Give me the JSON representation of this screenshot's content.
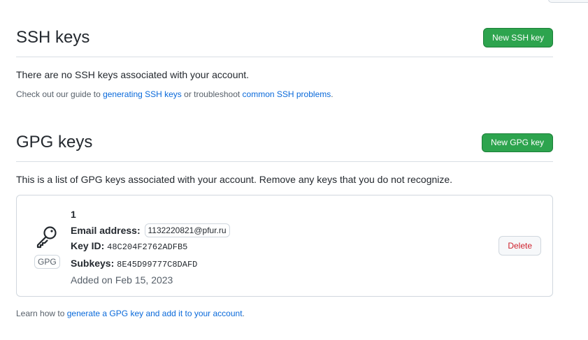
{
  "ssh": {
    "title": "SSH keys",
    "new_button": "New SSH key",
    "empty_message": "There are no SSH keys associated with your account.",
    "help_prefix": "Check out our guide to ",
    "help_link_guide": "generating SSH keys",
    "help_middle": " or troubleshoot ",
    "help_link_problems": "common SSH problems",
    "help_suffix": "."
  },
  "gpg": {
    "title": "GPG keys",
    "new_button": "New GPG key",
    "description": "This is a list of GPG keys associated with your account. Remove any keys that you do not recognize.",
    "keys": [
      {
        "name": "1",
        "badge": "GPG",
        "email_label": "Email address:",
        "email": "1132220821@pfur.ru",
        "key_id_label": "Key ID:",
        "key_id": "48C204F2762ADFB5",
        "subkeys_label": "Subkeys:",
        "subkeys": "8E45D99777C8DAFD",
        "added": "Added on Feb 15, 2023",
        "delete_label": "Delete"
      }
    ],
    "learn_prefix": "Learn how to ",
    "learn_link": "generate a GPG key and add it to your account",
    "learn_suffix": "."
  },
  "icons": {
    "key": "key-icon"
  },
  "colors": {
    "primary_button": "#2da44e",
    "link": "#0969da",
    "danger": "#cf222e",
    "border": "#d0d7de"
  }
}
